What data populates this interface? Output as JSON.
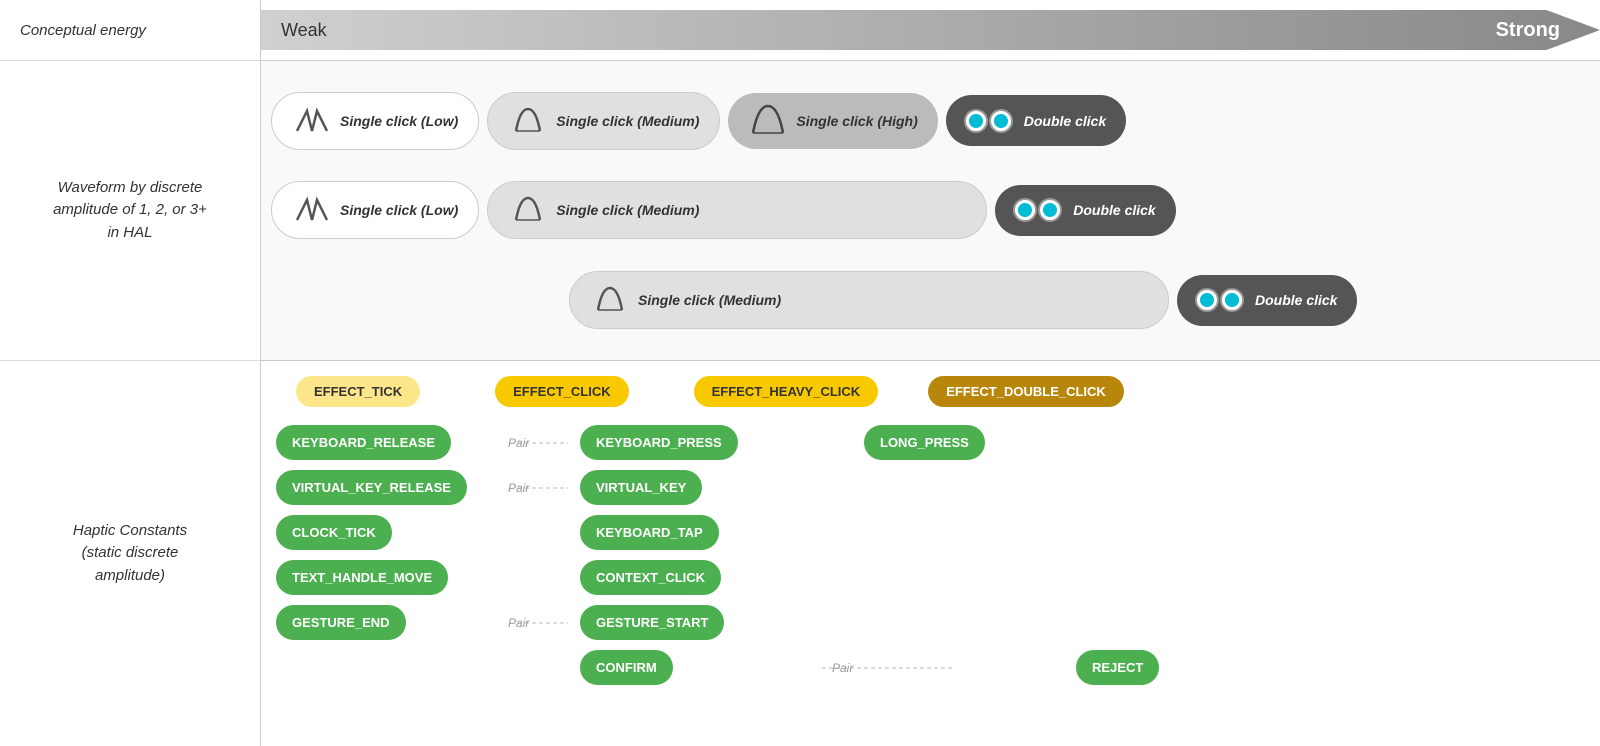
{
  "conceptual_energy": {
    "label": "Conceptual energy",
    "weak": "Weak",
    "strong": "Strong"
  },
  "waveform_label": "Waveform by discrete\namplitude of 1, 2, or 3+\nin HAL",
  "haptic_label": "Haptic Constants\n(static discrete\namplitude)",
  "waveform_rows": [
    {
      "pills": [
        {
          "type": "white",
          "icon": "wave-low",
          "text": "Single click (Low)"
        },
        {
          "type": "light-gray",
          "icon": "wave-medium",
          "text": "Single click (Medium)"
        },
        {
          "type": "medium-gray",
          "icon": "wave-high",
          "text": "Single click (High)"
        },
        {
          "type": "dark",
          "icon": "double-dot",
          "text": "Double click"
        }
      ]
    },
    {
      "pills": [
        {
          "type": "white",
          "icon": "wave-low",
          "text": "Single click (Low)"
        },
        {
          "type": "light-gray",
          "icon": "wave-medium",
          "text": "Single click (Medium)"
        },
        {
          "type": "dark",
          "icon": "double-dot",
          "text": "Double click"
        }
      ]
    },
    {
      "pills": [
        {
          "type": "light-gray",
          "icon": "wave-medium",
          "text": "Single click (Medium)"
        },
        {
          "type": "dark",
          "icon": "double-dot",
          "text": "Double click"
        }
      ],
      "indent": true
    }
  ],
  "effect_badges": [
    {
      "label": "EFFECT_TICK",
      "style": "light-yellow"
    },
    {
      "label": "EFFECT_CLICK",
      "style": "yellow"
    },
    {
      "label": "EFFECT_HEAVY_CLICK",
      "style": "yellow"
    },
    {
      "label": "EFFECT_DOUBLE_CLICK",
      "style": "dark-yellow"
    }
  ],
  "haptic_rows": [
    {
      "col1": "KEYBOARD_RELEASE",
      "pair": "Pair",
      "col2": "KEYBOARD_PRESS",
      "col3": "LONG_PRESS",
      "col4": null
    },
    {
      "col1": "VIRTUAL_KEY_RELEASE",
      "pair": "Pair",
      "col2": "VIRTUAL_KEY",
      "col3": null,
      "col4": null
    },
    {
      "col1": "CLOCK_TICK",
      "pair": null,
      "col2": "KEYBOARD_TAP",
      "col3": null,
      "col4": null
    },
    {
      "col1": "TEXT_HANDLE_MOVE",
      "pair": null,
      "col2": "CONTEXT_CLICK",
      "col3": null,
      "col4": null
    },
    {
      "col1": "GESTURE_END",
      "pair": "Pair",
      "col2": "GESTURE_START",
      "col3": null,
      "col4": null
    },
    {
      "col1": null,
      "pair": null,
      "col2": "CONFIRM",
      "pair2": "Pair",
      "col3": null,
      "col4": "REJECT"
    }
  ]
}
